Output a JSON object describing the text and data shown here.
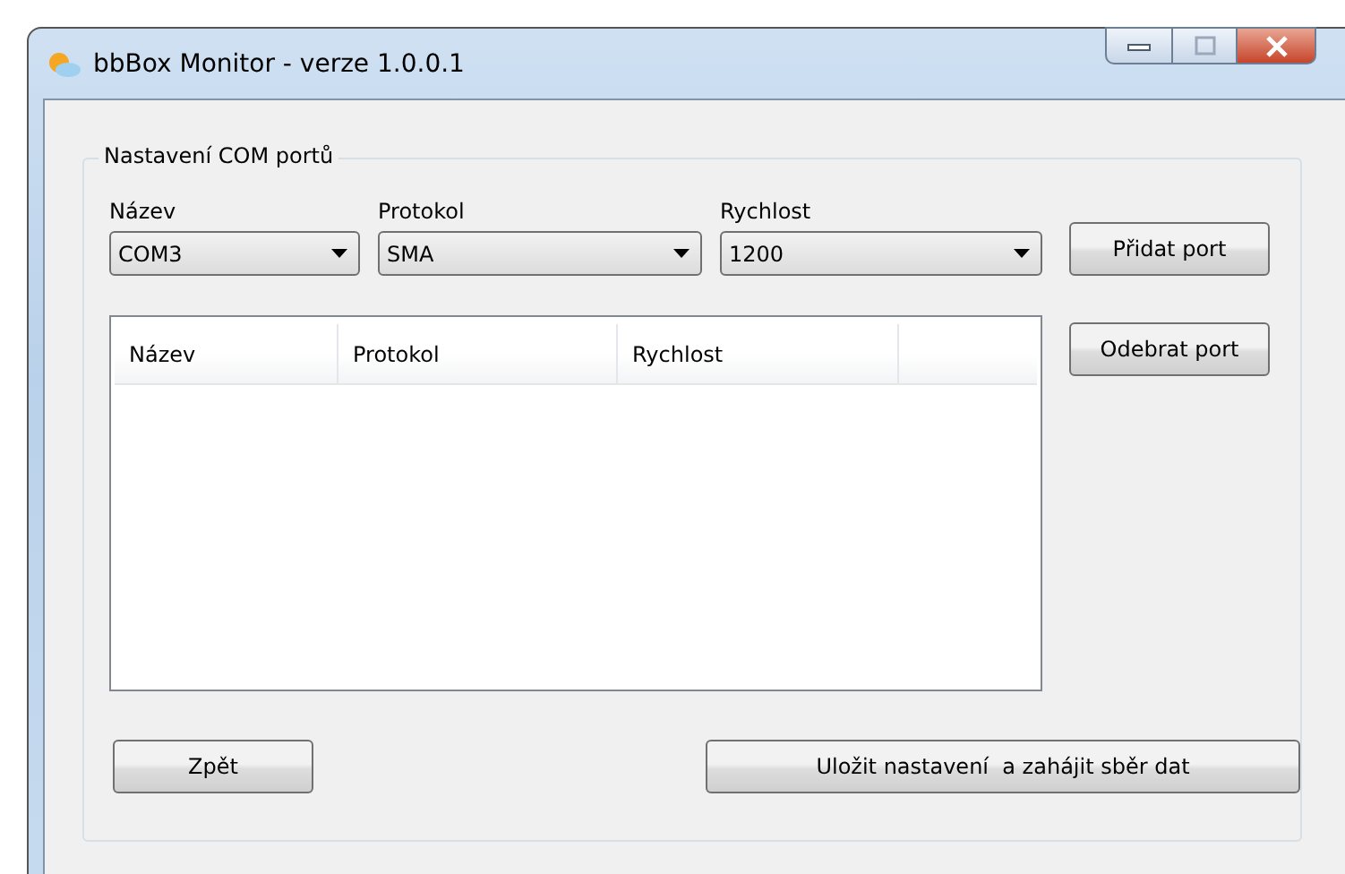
{
  "window": {
    "title": "bbBox Monitor - verze 1.0.0.1"
  },
  "group": {
    "title": "Nastavení COM portů"
  },
  "fields": [
    {
      "label": "Název",
      "value": "COM3"
    },
    {
      "label": "Protokol",
      "value": "SMA"
    },
    {
      "label": "Rychlost",
      "value": "1200"
    }
  ],
  "side_buttons": [
    "Přidat port",
    "Odebrat port"
  ],
  "table": {
    "columns": [
      "Název",
      "Protokol",
      "Rychlost"
    ]
  },
  "footer_buttons": [
    "Zpět",
    "Uložit nastavení  a zahájit sběr dat"
  ]
}
